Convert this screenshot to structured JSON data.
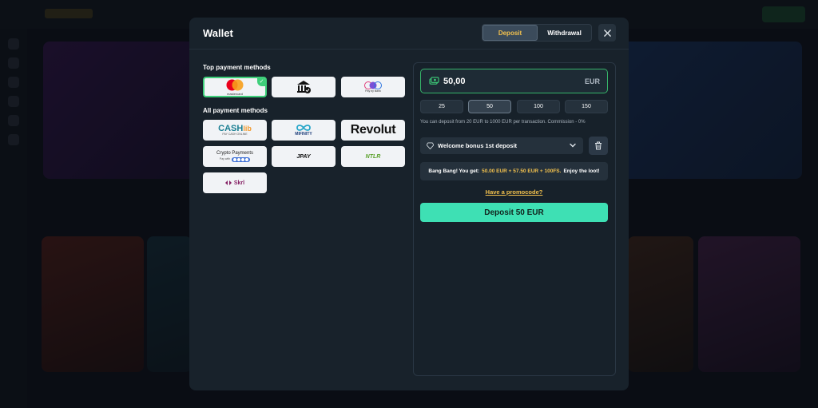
{
  "wallet": {
    "title": "Wallet",
    "tabs": [
      {
        "label": "Deposit",
        "active": true
      },
      {
        "label": "Withdrawal",
        "active": false
      }
    ],
    "close_icon": "close-icon"
  },
  "payment_methods": {
    "top_title": "Top payment methods",
    "all_title": "All payment methods",
    "top": [
      {
        "name": "mastercard",
        "text": "mastercard",
        "selected": true
      },
      {
        "name": "bank-transfer",
        "text": "",
        "selected": false
      },
      {
        "name": "pay-by-bank",
        "text": "Pay by Bank",
        "selected": false
      }
    ],
    "all": [
      {
        "name": "cashlib",
        "text": "CASH",
        "text2": "lib",
        "sub": "PAY CASH ONLINE"
      },
      {
        "name": "mifinity",
        "text": "MIFINITY"
      },
      {
        "name": "revolut",
        "text": "Revolut"
      },
      {
        "name": "crypto",
        "text": "Crypto Payments",
        "sub": "Pay with"
      },
      {
        "name": "jpay",
        "text": "JPAY"
      },
      {
        "name": "neteller",
        "text": "NTLR"
      },
      {
        "name": "skrill",
        "text": "Skrl"
      }
    ]
  },
  "deposit": {
    "amount": "50,00",
    "currency": "EUR",
    "quick_amounts": [
      {
        "label": "25",
        "active": false
      },
      {
        "label": "50",
        "active": true
      },
      {
        "label": "100",
        "active": false
      },
      {
        "label": "150",
        "active": false
      }
    ],
    "info": "You can deposit from 20 EUR to 1000 EUR per transaction. Commission - 0%",
    "bonus_select": "Welcome bonus 1st deposit",
    "bonus_message": {
      "prefix": "Bang Bang! You get:",
      "highlight": "50.00 EUR + 57.50 EUR + 100FS.",
      "suffix": "Enjoy the loot!"
    },
    "promo_link": "Have a promocode?",
    "submit_label": "Deposit 50 EUR"
  },
  "colors": {
    "accent_yellow": "#f2c14e",
    "accent_teal": "#3ee0b4",
    "selected_green": "#3ecf7a"
  }
}
